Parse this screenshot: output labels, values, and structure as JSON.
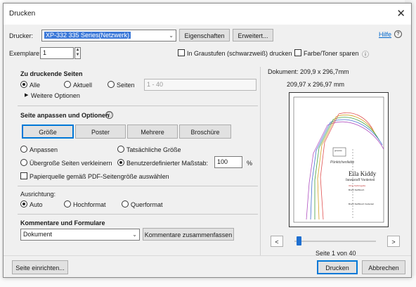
{
  "dialog": {
    "title": "Drucken",
    "close_glyph": "✕"
  },
  "printer": {
    "label": "Drucker:",
    "value": "XP-332 335 Series(Netzwerk)",
    "properties_button": "Eigenschaften",
    "advanced_button": "Erweitert...",
    "help_link": "Hilfe"
  },
  "copies": {
    "label": "Exemplare:",
    "value": "1"
  },
  "options_row": {
    "grayscale_label": "In Graustufen (schwarzweiß) drucken",
    "save_toner_label": "Farbe/Toner sparen"
  },
  "pages": {
    "heading": "Zu druckende Seiten",
    "all_label": "Alle",
    "current_label": "Aktuell",
    "pages_label": "Seiten",
    "range_placeholder": "1 - 40",
    "more_options": "Weitere Optionen",
    "selected": "Alle"
  },
  "fit": {
    "heading": "Seite anpassen und Optionen",
    "tabs": [
      "Größe",
      "Poster",
      "Mehrere",
      "Broschüre"
    ],
    "fit_label": "Anpassen",
    "actual_label": "Tatsächliche Größe",
    "shrink_label": "Übergroße Seiten verkleinern",
    "custom_label": "Benutzerdefinierter Maßstab:",
    "scale_value": "100",
    "scale_unit": "%",
    "paper_source_label": "Papierquelle gemäß PDF-Seitengröße auswählen",
    "selected": "Benutzerdefinierter Maßstab:"
  },
  "orientation": {
    "heading": "Ausrichtung:",
    "auto_label": "Auto",
    "portrait_label": "Hochformat",
    "landscape_label": "Querformat",
    "selected": "Auto"
  },
  "comments": {
    "heading": "Kommentare und Formulare",
    "value": "Dokument",
    "summarize_button": "Kommentare zusammenfassen"
  },
  "preview": {
    "document_size": "Dokument: 209,9 x 296,7mm",
    "page_size": "209,97 x 296,97 mm",
    "page_info": "Seite 1 von 40",
    "prev_glyph": "<",
    "next_glyph": ">",
    "slider_position": 0.025,
    "pattern_title": "Eila Kiddy",
    "pattern_subtitle": "Innenstoff Vorderteil",
    "pattern_note": "Ohne Nahtzugabe",
    "pattern_note2": "Bruch Stoffbruch",
    "pattern_footer": "Bruch Stoffbruch Vorderteil",
    "pattern_box": "groesse",
    "pattern_logo": "Pünktchenliebe"
  },
  "footer": {
    "page_setup_button": "Seite einrichten...",
    "print_button": "Drucken",
    "cancel_button": "Abbrechen"
  },
  "icons": {
    "help": "ⓘ",
    "help_circle": "?",
    "triangle": "▶",
    "dropdown": "⌄"
  },
  "colors": {
    "accent": "#0078d7",
    "selection": "#3b78d8",
    "slider": "#1e6fd0"
  }
}
